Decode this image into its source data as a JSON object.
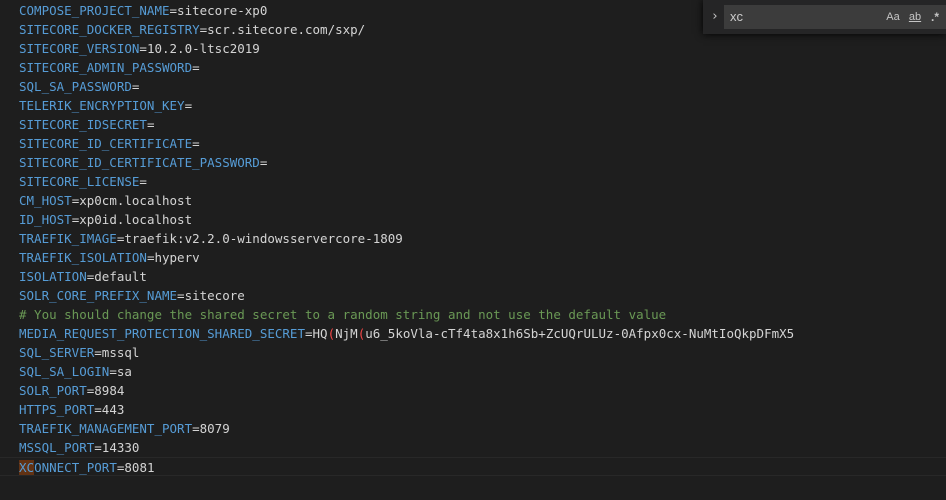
{
  "lines": [
    {
      "key": "COMPOSE_PROJECT_NAME",
      "sep": "=",
      "value": "sitecore-xp0"
    },
    {
      "key": "SITECORE_DOCKER_REGISTRY",
      "sep": "=",
      "value": "scr.sitecore.com/sxp/"
    },
    {
      "key": "SITECORE_VERSION",
      "sep": "=",
      "value": "10.2.0-ltsc2019"
    },
    {
      "key": "SITECORE_ADMIN_PASSWORD",
      "sep": "=",
      "value": ""
    },
    {
      "key": "SQL_SA_PASSWORD",
      "sep": "=",
      "value": ""
    },
    {
      "key": "TELERIK_ENCRYPTION_KEY",
      "sep": "=",
      "value": ""
    },
    {
      "key": "SITECORE_IDSECRET",
      "sep": "=",
      "value": ""
    },
    {
      "key": "SITECORE_ID_CERTIFICATE",
      "sep": "=",
      "value": ""
    },
    {
      "key": "SITECORE_ID_CERTIFICATE_PASSWORD",
      "sep": "=",
      "value": ""
    },
    {
      "key": "SITECORE_LICENSE",
      "sep": "=",
      "value": ""
    },
    {
      "key": "CM_HOST",
      "sep": "=",
      "value": "xp0cm.localhost"
    },
    {
      "key": "ID_HOST",
      "sep": "=",
      "value": "xp0id.localhost"
    },
    {
      "key": "TRAEFIK_IMAGE",
      "sep": "=",
      "value": "traefik:v2.2.0-windowsservercore-1809"
    },
    {
      "key": "TRAEFIK_ISOLATION",
      "sep": "=",
      "value": "hyperv"
    },
    {
      "key": "ISOLATION",
      "sep": "=",
      "value": "default"
    },
    {
      "key": "SOLR_CORE_PREFIX_NAME",
      "sep": "=",
      "value": "sitecore"
    },
    {
      "comment": "# You should change the shared secret to a random string and not use the default value"
    },
    {
      "key": "MEDIA_REQUEST_PROTECTION_SHARED_SECRET",
      "sep": "=",
      "segments": [
        {
          "t": "HQ",
          "c": "v"
        },
        {
          "t": "(",
          "c": "bad"
        },
        {
          "t": "NjM",
          "c": "v"
        },
        {
          "t": "(",
          "c": "bad"
        },
        {
          "t": "u6_5koVla-cTf4ta8x1h6Sb+ZcUQrULUz-0Afpx0cx-NuMtIoQkpDFmX5",
          "c": "v"
        }
      ]
    },
    {
      "key": "SQL_SERVER",
      "sep": "=",
      "value": "mssql"
    },
    {
      "key": "SQL_SA_LOGIN",
      "sep": "=",
      "value": "sa"
    },
    {
      "key": "SOLR_PORT",
      "sep": "=",
      "value": "8984"
    },
    {
      "key": "HTTPS_PORT",
      "sep": "=",
      "value": "443"
    },
    {
      "key": "TRAEFIK_MANAGEMENT_PORT",
      "sep": "=",
      "value": "8079"
    },
    {
      "key": "MSSQL_PORT",
      "sep": "=",
      "value": "14330"
    },
    {
      "key_match": "XC",
      "key": "ONNECT_PORT",
      "sep": "=",
      "value": "8081",
      "current": true
    }
  ],
  "find_widget": {
    "expand_icon": "chevron-right-icon",
    "expand_glyph": "›",
    "query": "xc",
    "match_case_label": "Aa",
    "match_word_label": "ab",
    "regex_label": ".*"
  },
  "colors": {
    "background": "#1e1e1e",
    "key": "#569cd6",
    "text": "#d4d4d4",
    "comment": "#6a9955",
    "error": "#f44747",
    "match": "#613214"
  }
}
